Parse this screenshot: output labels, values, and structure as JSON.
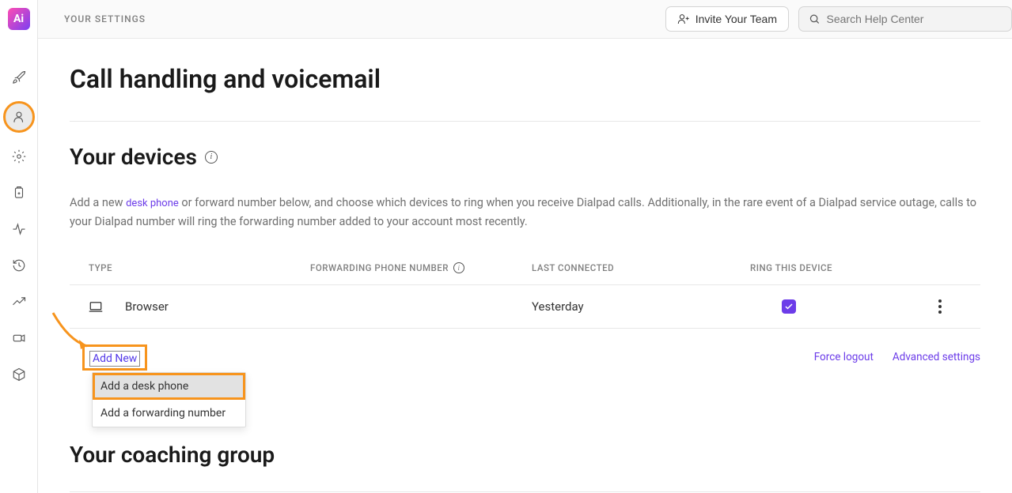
{
  "topbar": {
    "label": "YOUR SETTINGS",
    "invite_label": "Invite Your Team",
    "search_placeholder": "Search Help Center"
  },
  "page": {
    "title": "Call handling and voicemail",
    "devices_title": "Your devices",
    "description_pre": "Add a new ",
    "description_link": "desk phone",
    "description_post": " or forward number below, and choose which devices to ring when you receive Dialpad calls. Additionally, in the rare event of a Dialpad service outage, calls to your Dialpad number will ring the forwarding number added to your account most recently.",
    "coaching_title": "Your coaching group"
  },
  "table": {
    "headers": {
      "type": "TYPE",
      "fwd": "FORWARDING PHONE NUMBER",
      "last": "LAST CONNECTED",
      "ring": "RING THIS DEVICE"
    },
    "rows": [
      {
        "device_name": "Browser",
        "fwd": "",
        "last": "Yesterday",
        "ring": true
      }
    ]
  },
  "actions": {
    "add_new": "Add New",
    "force_logout": "Force logout",
    "advanced_settings": "Advanced settings"
  },
  "dropdown": {
    "items": [
      {
        "label": "Add a desk phone",
        "highlighted": true
      },
      {
        "label": "Add a forwarding number",
        "highlighted": false
      }
    ]
  },
  "logo_text": "Ai"
}
